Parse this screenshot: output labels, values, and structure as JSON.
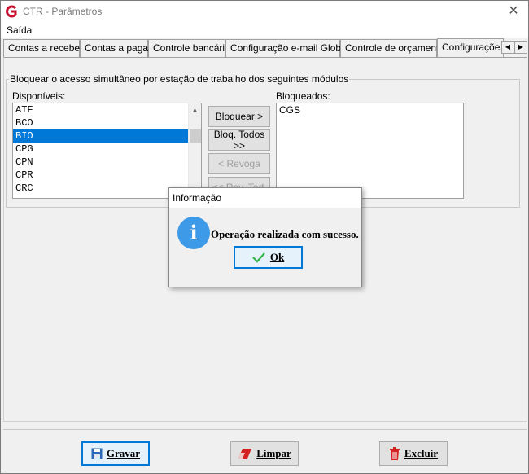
{
  "window": {
    "title": "CTR - Parâmetros"
  },
  "menu": {
    "items": [
      "Saída"
    ]
  },
  "tabs": [
    "Contas a receber",
    "Contas a pagar",
    "Controle bancário",
    "Configuração e-mail Globus",
    "Controle de orçamento",
    "Configurações"
  ],
  "group": {
    "caption": "Bloquear o acesso simultâneo por estação de trabalho  dos seguintes módulos",
    "available_label": "Disponíveis:",
    "blocked_label": "Bloqueados:",
    "available_items": [
      "ATF",
      "BCO",
      "BIO",
      "CPG",
      "CPN",
      "CPR",
      "CRC"
    ],
    "selected_available": "BIO",
    "blocked_items": [
      "CGS"
    ],
    "buttons": {
      "block": "Bloquear >",
      "block_all": "Bloq. Todos >>",
      "revoke": "< Revoga",
      "revoke_all": "<< Rev. Tod."
    }
  },
  "dialog": {
    "title": "Informação",
    "message": "Operação realizada com sucesso.",
    "ok": "Ok"
  },
  "bottom": {
    "save": "Gravar",
    "clear": "Limpar",
    "delete": "Excluir"
  },
  "colors": {
    "selection": "#0078d7",
    "info_icon": "#3c9ae8",
    "delete_icon": "#d42020",
    "save_icon": "#2a6ab8"
  }
}
